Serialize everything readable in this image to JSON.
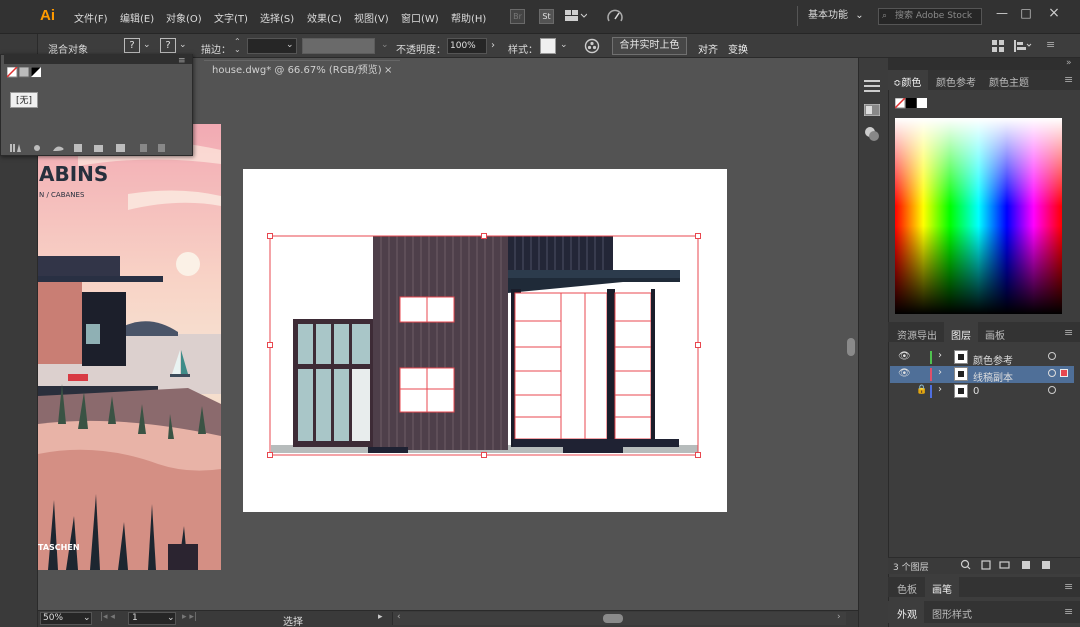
{
  "app": {
    "logo": "Ai",
    "menus": [
      "文件(F)",
      "编辑(E)",
      "对象(O)",
      "文字(T)",
      "选择(S)",
      "效果(C)",
      "视图(V)",
      "窗口(W)",
      "帮助(H)"
    ],
    "bridge_label": "Br",
    "stock_label": "St",
    "workspace": "基本功能",
    "search_placeholder": "搜索 Adobe Stock"
  },
  "control_bar": {
    "selection_type": "混合对象",
    "stroke_label": "描边：",
    "opacity_label": "不透明度：",
    "opacity_value": "100%",
    "style_label": "样式：",
    "merge_button": "合并实时上色",
    "align_label": "对齐",
    "transform_label": "变换",
    "unknown_mark": "?"
  },
  "swatch_flyout": {
    "none_label": "[无]"
  },
  "document": {
    "tab_title": "house.dwg* @ 66.67% (RGB/预览)",
    "close_glyph": "×"
  },
  "poster": {
    "title_fragment": "ABINS",
    "subtitle_fragment": "N / CABANES",
    "publisher_fragment": "TASCHEN"
  },
  "color_panel": {
    "tabs": [
      "颜色",
      "颜色参考",
      "颜色主题"
    ]
  },
  "layers_panel": {
    "tabs": [
      "资源导出",
      "图层",
      "画板"
    ],
    "layers": [
      {
        "name": "颜色参考",
        "color": "#4fc24f",
        "selected": false
      },
      {
        "name": "线稿副本",
        "color": "#e0506a",
        "selected": true
      },
      {
        "name": "0",
        "color": "#4f6fe0",
        "selected": false
      }
    ],
    "count_label": "3 个图层"
  },
  "lower_panels": {
    "tabs_a": [
      "色板",
      "画笔"
    ],
    "tabs_b": [
      "外观",
      "图形样式"
    ]
  },
  "status_bar": {
    "zoom": "50%",
    "page": "1",
    "tool": "选择"
  },
  "colors": {
    "accent_orange": "#ff9a00",
    "selection_red": "#e8474f",
    "house_dark": "#4b3a45",
    "house_navy": "#1c2033",
    "glass": "#a7c5c8"
  }
}
